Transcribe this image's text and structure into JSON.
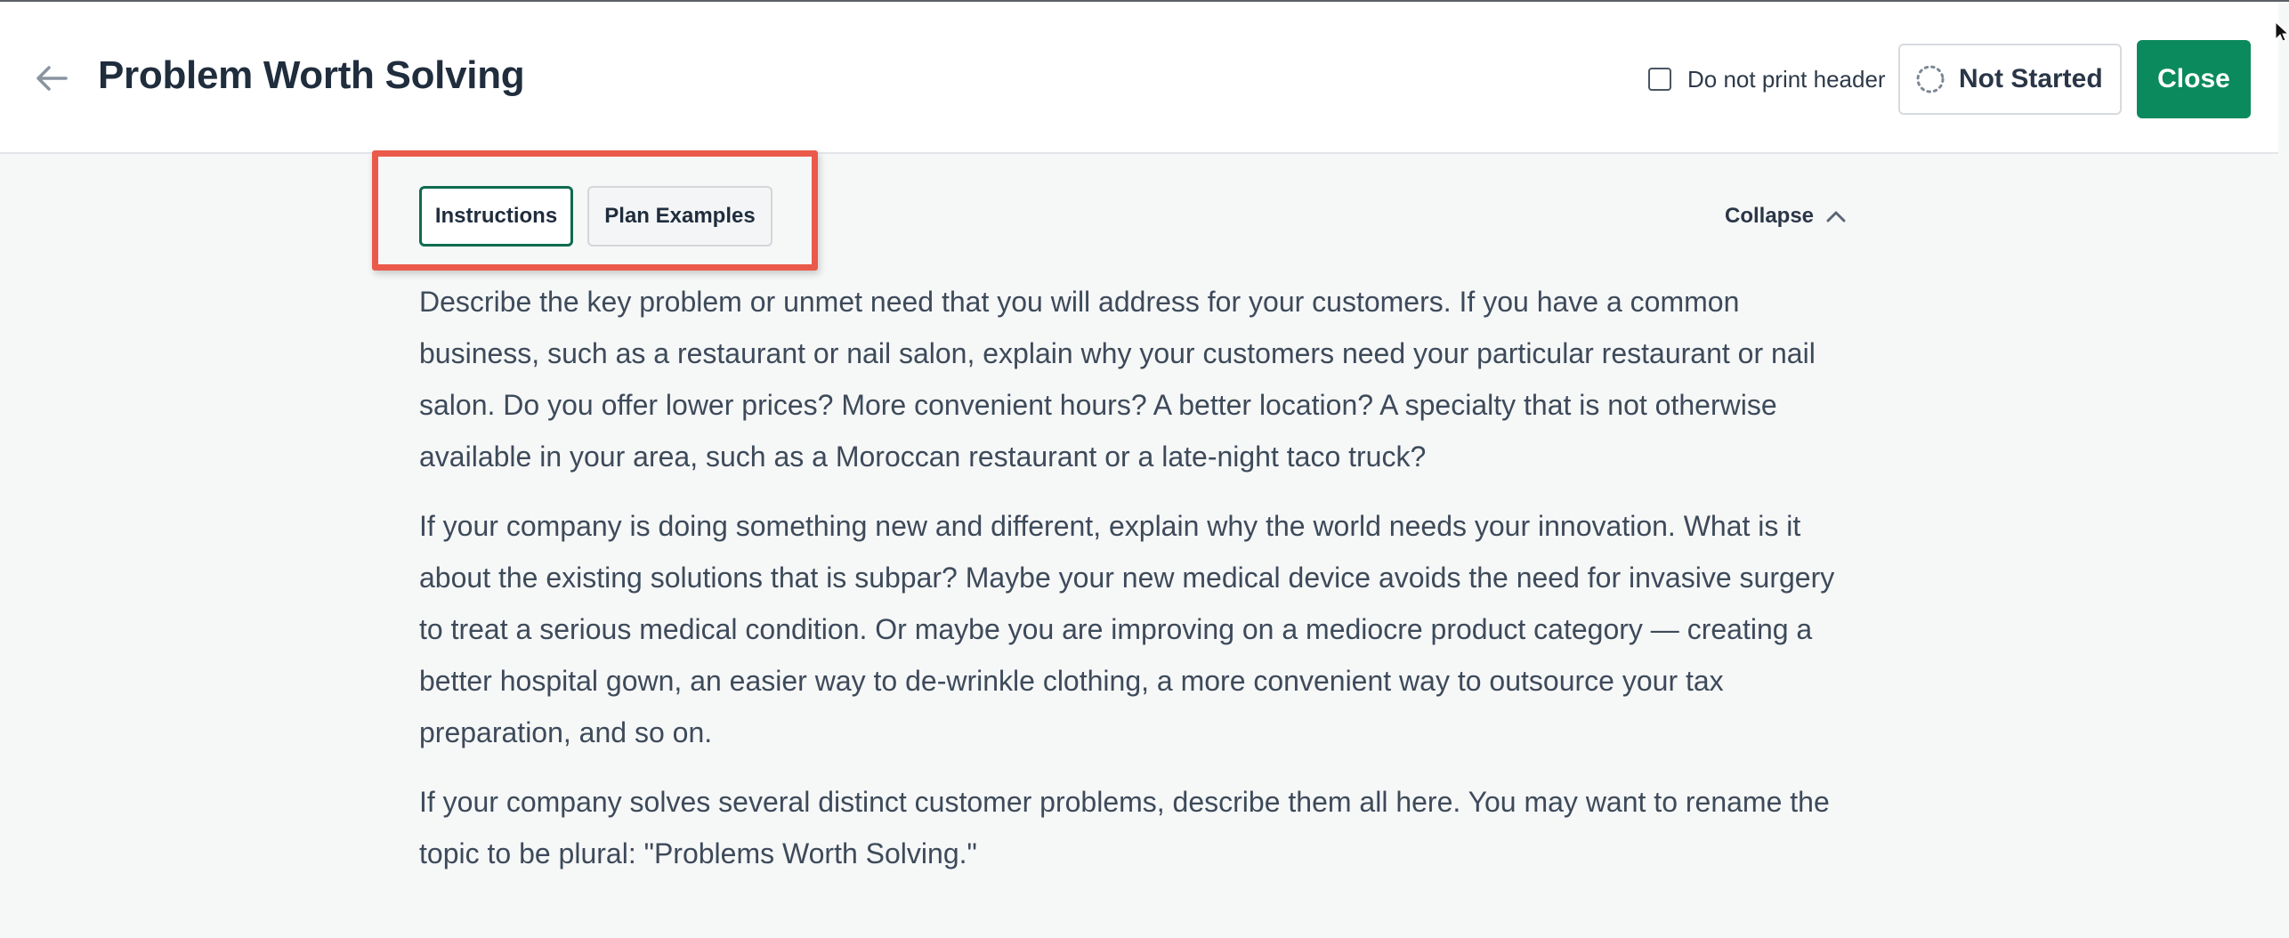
{
  "header": {
    "title": "Problem Worth Solving",
    "print_header_label": "Do not print header",
    "status_label": "Not Started",
    "close_label": "Close"
  },
  "tabs": [
    {
      "label": "Instructions",
      "active": true
    },
    {
      "label": "Plan Examples",
      "active": false
    }
  ],
  "collapse_label": "Collapse",
  "instructions": {
    "paragraphs": [
      "Describe the key problem or unmet need that you will address for your customers. If you have a common business, such as a restaurant or nail salon, explain why your customers need your particular restaurant or nail salon. Do you offer lower prices? More convenient hours? A better location? A specialty that is not otherwise available in your area, such as a Moroccan restaurant or a late-night taco truck?",
      "If your company is doing something new and different, explain why the world needs your innovation. What is it about the existing solutions that is subpar? Maybe your new medical device avoids the need for invasive surgery to treat a serious medical condition. Or maybe you are improving on a mediocre product category — creating a better hospital gown, an easier way to de-wrinkle clothing, a more convenient way to outsource your tax preparation, and so on.",
      "If your company solves several distinct customer problems, describe them all here. You may want to rename the topic to be plural: \"Problems Worth Solving.\""
    ]
  },
  "icons": {
    "back": "arrow-left-icon",
    "status": "dotted-circle-icon",
    "collapse": "chevron-up-icon"
  },
  "colors": {
    "accent": "#0b8a5d",
    "active_tab_border": "#0d6b4f",
    "highlight": "#ea5a4a"
  }
}
